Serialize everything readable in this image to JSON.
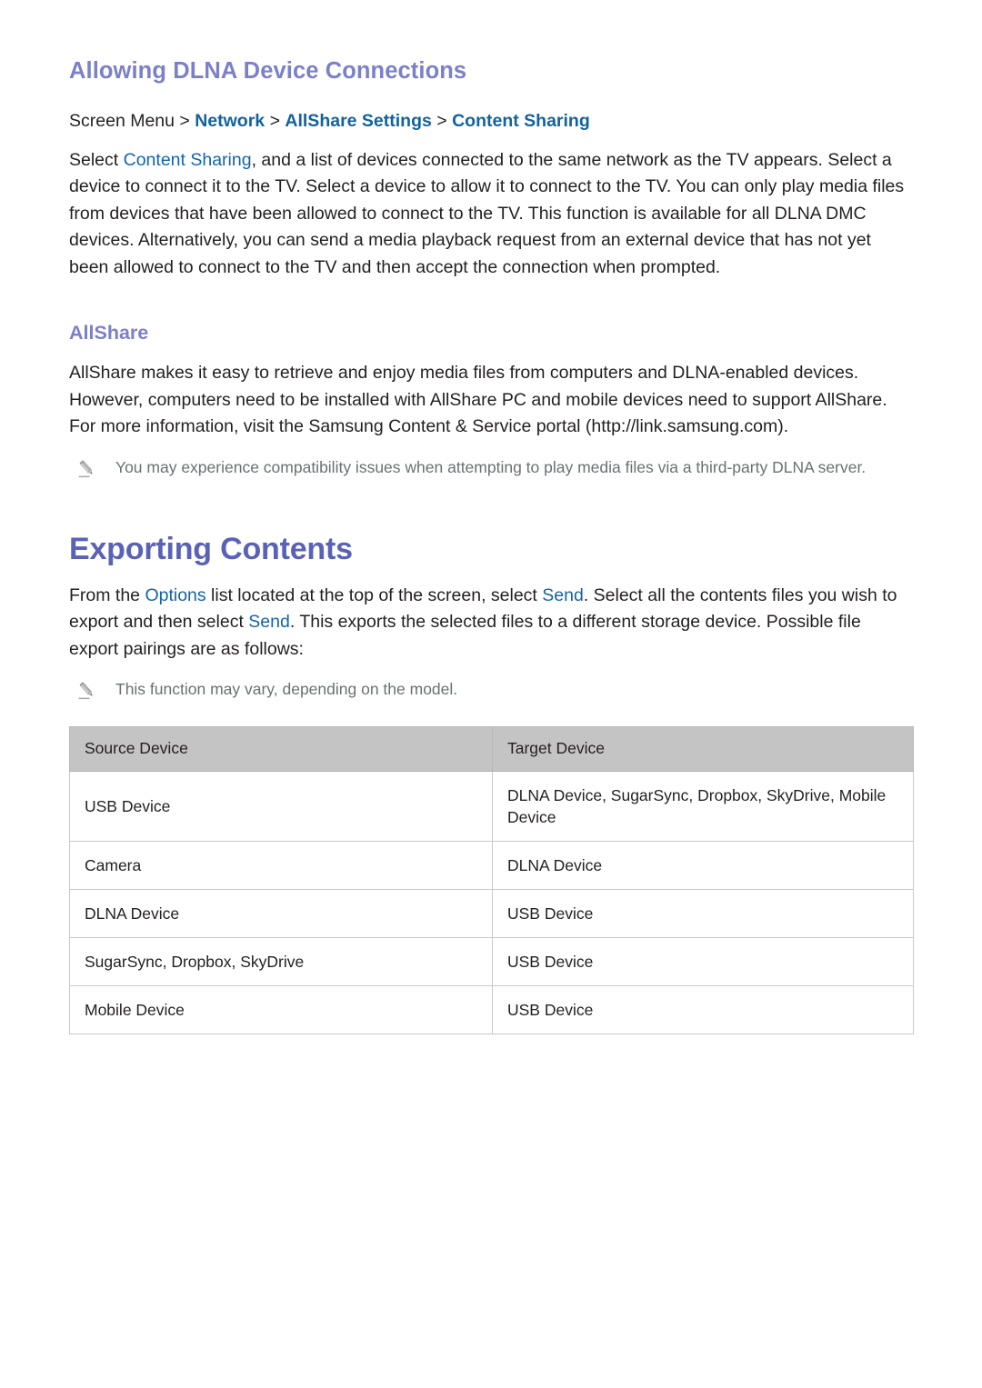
{
  "document": {
    "section1": {
      "heading": "Allowing DLNA Device Connections",
      "breadcrumb": {
        "prefix": "Screen Menu",
        "sep": ">",
        "items": [
          "Network",
          "AllShare Settings",
          "Content Sharing"
        ]
      },
      "paragraph": {
        "part1": "Select ",
        "link1": "Content Sharing",
        "part2": ", and a list of devices connected to the same network as the TV appears. Select a device to connect it to the TV. Select a device to allow it to connect to the TV. You can only play media files from devices that have been allowed to connect to the TV. This function is available for all DLNA DMC devices. Alternatively, you can send a media playback request from an external device that has not yet been allowed to connect to the TV and then accept the connection when prompted."
      }
    },
    "section2": {
      "heading": "AllShare",
      "paragraph": "AllShare makes it easy to retrieve and enjoy media files from computers and DLNA-enabled devices. However, computers need to be installed with AllShare PC and mobile devices need to support AllShare. For more information, visit the Samsung Content & Service portal (http://link.samsung.com).",
      "note": "You may experience compatibility issues when attempting to play media files via a third-party DLNA server."
    },
    "section3": {
      "heading": "Exporting Contents",
      "paragraph": {
        "part1": "From the ",
        "link1": "Options",
        "part2": " list located at the top of the screen, select ",
        "link2": "Send",
        "part3": ". Select all the contents files you wish to export and then select ",
        "link3": "Send",
        "part4": ". This exports the selected files to a different storage device. Possible file export pairings are as follows:"
      },
      "note": "This function may vary, depending on the model.",
      "table": {
        "headers": [
          "Source Device",
          "Target Device"
        ],
        "rows": [
          [
            "USB Device",
            "DLNA Device, SugarSync, Dropbox, SkyDrive, Mobile Device"
          ],
          [
            "Camera",
            "DLNA Device"
          ],
          [
            "DLNA Device",
            "USB Device"
          ],
          [
            "SugarSync, Dropbox, SkyDrive",
            "USB Device"
          ],
          [
            "Mobile Device",
            "USB Device"
          ]
        ]
      }
    }
  },
  "icons": {
    "note": "pencil-icon"
  },
  "colors": {
    "heading_purple_light": "#7b80c8",
    "heading_purple_main": "#5a62b5",
    "link_blue": "#1464aa",
    "breadcrumb_blue": "#11639f",
    "note_gray": "#6d6f72",
    "table_header_bg": "#c4c4c4",
    "table_border": "#c9c9c9",
    "body_text": "#231f20"
  }
}
